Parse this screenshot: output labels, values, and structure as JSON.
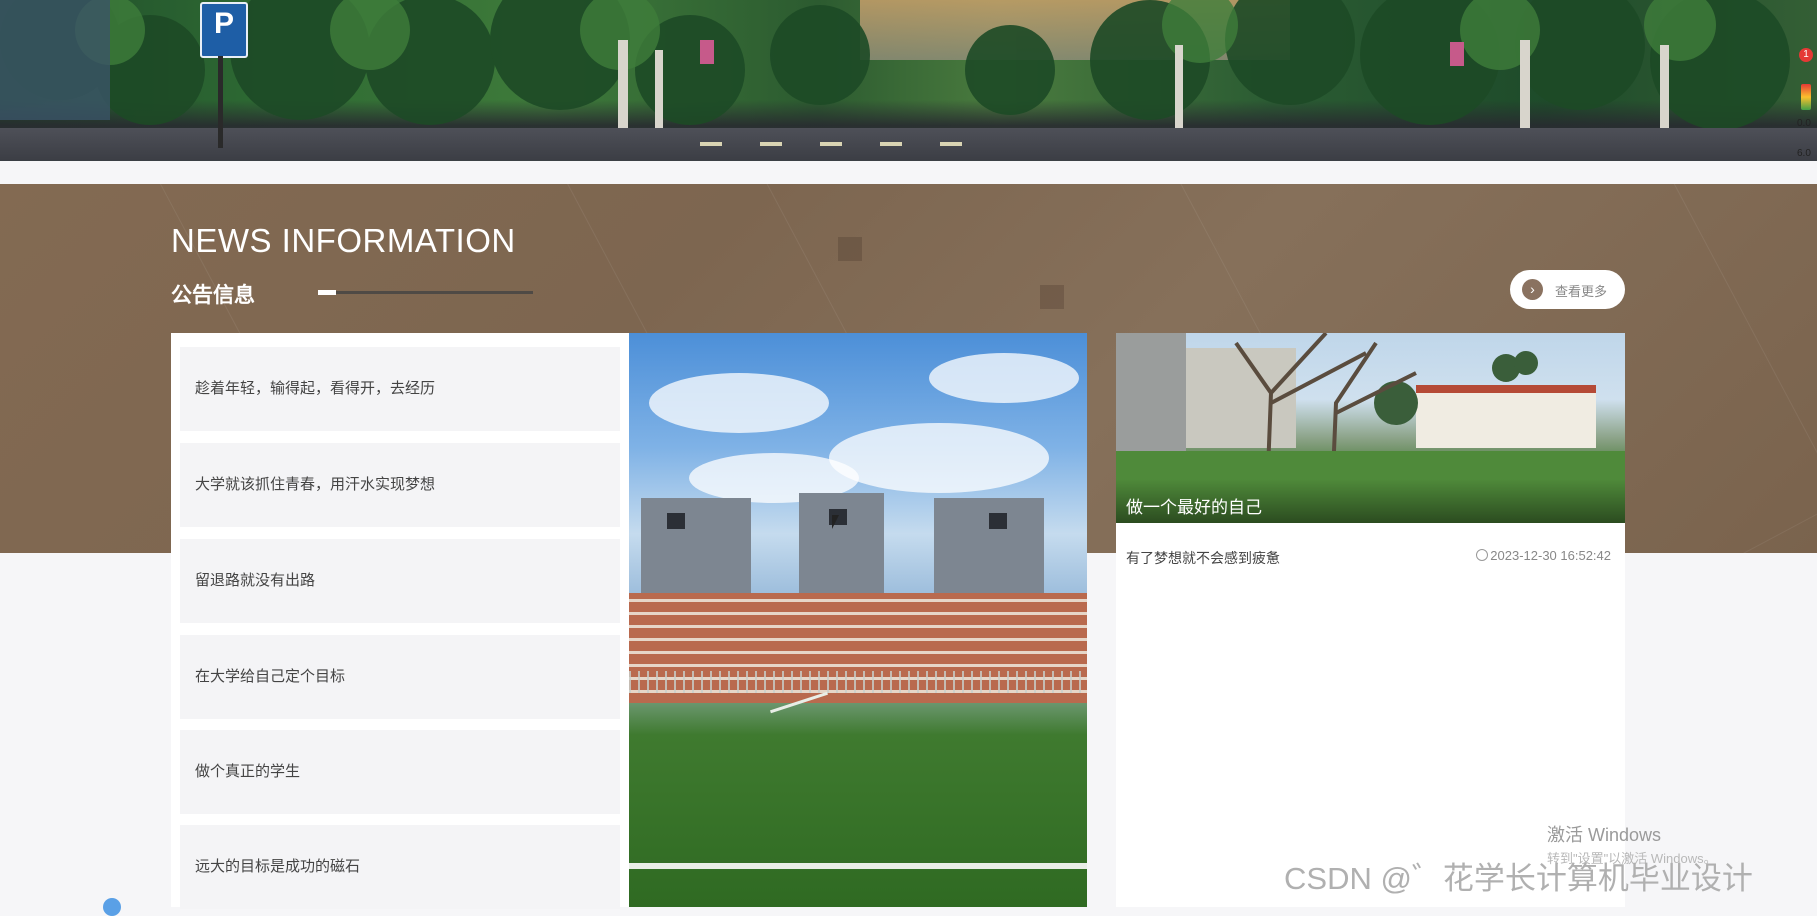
{
  "section": {
    "title_en": "NEWS INFORMATION",
    "title_cn": "公告信息",
    "view_more": "查看更多"
  },
  "news_list": [
    {
      "title": "趁着年轻，输得起，看得开，去经历"
    },
    {
      "title": "大学就该抓住青春，用汗水实现梦想"
    },
    {
      "title": "留退路就没有出路"
    },
    {
      "title": "在大学给自己定个目标"
    },
    {
      "title": "做个真正的学生"
    },
    {
      "title": "远大的目标是成功的磁石"
    }
  ],
  "featured": {
    "caption": "做一个最好的自己",
    "summary": "有了梦想就不会感到疲惫",
    "date": "2023-12-30 16:52:42"
  },
  "edge_widget": {
    "badge": "1",
    "line1": "0.0",
    "line2": "6.0"
  },
  "watermark": {
    "windows_title": "激活 Windows",
    "windows_sub": "转到\"设置\"以激活 Windows。",
    "csdn": "CSDN @゛花学长计算机毕业设计"
  },
  "icons": {
    "view_more": "chevron-right-circle-icon",
    "date": "clock-icon",
    "parking": "parking-sign-icon"
  },
  "colors": {
    "band": "#836a52",
    "card_bg": "#ffffff",
    "item_bg": "#f4f4f6"
  }
}
